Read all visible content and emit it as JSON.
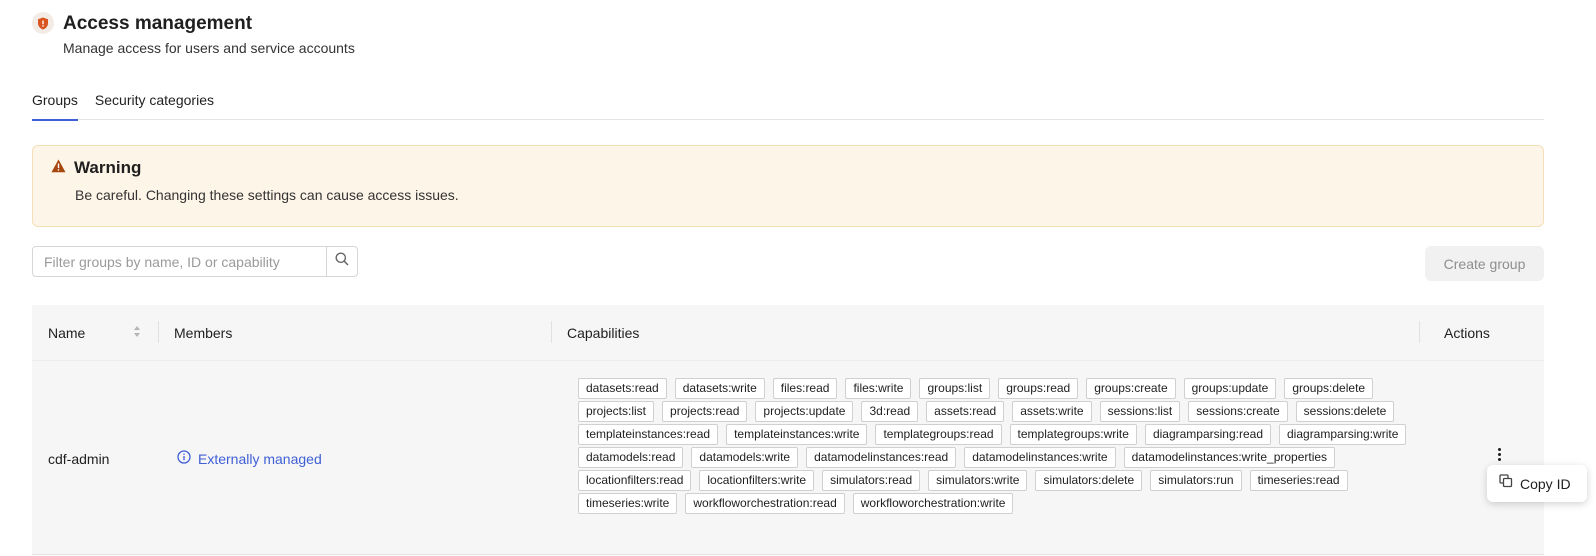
{
  "header": {
    "icon": "shield-icon",
    "title": "Access management",
    "subtitle": "Manage access for users and service accounts"
  },
  "tabs": [
    {
      "label": "Groups",
      "active": true
    },
    {
      "label": "Security categories",
      "active": false
    }
  ],
  "warning": {
    "icon": "warning-triangle-icon",
    "title": "Warning",
    "message": "Be careful. Changing these settings can cause access issues."
  },
  "search": {
    "placeholder": "Filter groups by name, ID or capability",
    "value": "",
    "icon": "search-icon"
  },
  "create_group_label": "Create group",
  "table": {
    "columns": {
      "name": "Name",
      "members": "Members",
      "capabilities": "Capabilities",
      "actions": "Actions"
    },
    "rows": [
      {
        "name": "cdf-admin",
        "members": "Externally managed",
        "capabilities": [
          "datasets:read",
          "datasets:write",
          "files:read",
          "files:write",
          "groups:list",
          "groups:read",
          "groups:create",
          "groups:update",
          "groups:delete",
          "projects:list",
          "projects:read",
          "projects:update",
          "3d:read",
          "assets:read",
          "assets:write",
          "sessions:list",
          "sessions:create",
          "sessions:delete",
          "templateinstances:read",
          "templateinstances:write",
          "templategroups:read",
          "templategroups:write",
          "diagramparsing:read",
          "diagramparsing:write",
          "datamodels:read",
          "datamodels:write",
          "datamodelinstances:read",
          "datamodelinstances:write",
          "datamodelinstances:write_properties",
          "locationfilters:read",
          "locationfilters:write",
          "simulators:read",
          "simulators:write",
          "simulators:delete",
          "simulators:run",
          "timeseries:read",
          "timeseries:write",
          "workfloworchestration:read",
          "workfloworchestration:write"
        ]
      }
    ]
  },
  "context_menu": {
    "item_label": "Copy ID",
    "icon": "copy-icon"
  },
  "colors": {
    "accent": "#3e5fd6",
    "warning_bg": "#fdf5e7",
    "shield": "#d9541e"
  }
}
